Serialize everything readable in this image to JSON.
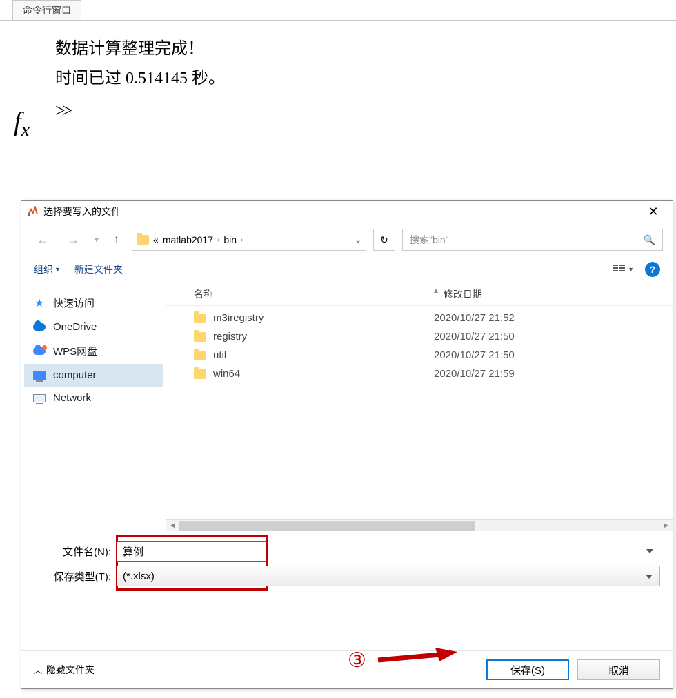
{
  "command_window": {
    "tab_title": "命令行窗口",
    "line1": "数据计算整理完成！",
    "line2": "时间已过 0.514145 秒。",
    "prompt": ">>"
  },
  "dialog": {
    "title": "选择要写入的文件",
    "breadcrumb": {
      "sep": "«",
      "parent": "matlab2017",
      "current": "bin"
    },
    "search_placeholder": "搜索\"bin\"",
    "toolbar": {
      "organize": "组织",
      "new_folder": "新建文件夹"
    },
    "columns": {
      "name": "名称",
      "date": "修改日期"
    },
    "nav": {
      "quick": "快速访问",
      "onedrive": "OneDrive",
      "wps": "WPS网盘",
      "computer": "computer",
      "network": "Network"
    },
    "files": [
      {
        "name": "m3iregistry",
        "date": "2020/10/27 21:52"
      },
      {
        "name": "registry",
        "date": "2020/10/27 21:50"
      },
      {
        "name": "util",
        "date": "2020/10/27 21:50"
      },
      {
        "name": "win64",
        "date": "2020/10/27 21:59"
      }
    ],
    "form": {
      "filename_label": "文件名(N):",
      "filename_value": "算例",
      "filetype_label": "保存类型(T):",
      "filetype_value": "(*.xlsx)"
    },
    "footer": {
      "hide_folders": "隐藏文件夹",
      "save": "保存(S)",
      "cancel": "取消"
    }
  },
  "annotation": {
    "number": "③"
  }
}
